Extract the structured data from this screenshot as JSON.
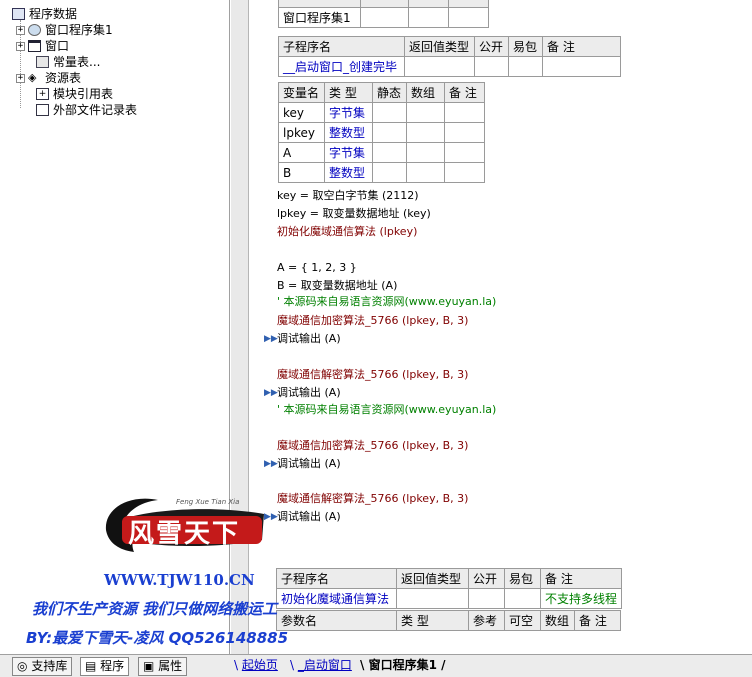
{
  "tree": {
    "root": "程序数据",
    "items": [
      "窗口程序集1",
      "窗口",
      "常量表...",
      "资源表",
      "模块引用表",
      "外部文件记录表"
    ]
  },
  "top_table": {
    "cells": [
      "窗口程序集1"
    ]
  },
  "sub1": {
    "headers": [
      "子程序名",
      "返回值类型",
      "公开",
      "易包",
      "备 注"
    ],
    "name": "__启动窗口_创建完毕"
  },
  "vars": {
    "headers": [
      "变量名",
      "类 型",
      "静态",
      "数组",
      "备 注"
    ],
    "rows": [
      [
        "key",
        "字节集"
      ],
      [
        "lpkey",
        "整数型"
      ],
      [
        "A",
        "字节集"
      ],
      [
        "B",
        "整数型"
      ]
    ]
  },
  "code": [
    "key = 取空白字节集 (2112)",
    "lpkey = 取变量数据地址 (key)",
    "初始化魔域通信算法 (lpkey)",
    "A = { 1, 2, 3 }",
    "B = 取变量数据地址 (A)",
    "' 本源码来自易语言资源网(www.eyuyan.la)",
    "魔域通信加密算法_5766 (lpkey, B, 3)",
    "调试输出 (A)",
    "魔域通信解密算法_5766 (lpkey, B, 3)",
    "调试输出 (A)",
    "' 本源码来自易语言资源网(www.eyuyan.la)",
    "魔域通信加密算法_5766 (lpkey, B, 3)",
    "调试输出 (A)",
    "魔域通信解密算法_5766 (lpkey, B, 3)",
    "调试输出 (A)"
  ],
  "sub2": {
    "headers": [
      "子程序名",
      "返回值类型",
      "公开",
      "易包",
      "备 注"
    ],
    "name": "初始化魔域通信算法",
    "note": "不支持多线程",
    "param_headers": [
      "参数名",
      "类 型",
      "参考",
      "可空",
      "数组",
      "备 注"
    ]
  },
  "watermark": {
    "logo": "风雪天下",
    "logo_sub": "Feng Xue Tian Xia",
    "url": "WWW.TJW110.CN",
    "line1": "我们不生产资源  我们只做网络搬运工",
    "line2": "BY:最爱下雪天-凌风 QQ526148885"
  },
  "bottom_tabs": {
    "left": [
      "支持库",
      "程序",
      "属性"
    ],
    "docs": [
      "起始页",
      "_启动窗口",
      "窗口程序集1"
    ]
  },
  "colors": {
    "type_blue": "#0000c0",
    "func_darkred": "#800000",
    "comment_green": "#008000",
    "watermark_blue": "#1a3fd0"
  }
}
